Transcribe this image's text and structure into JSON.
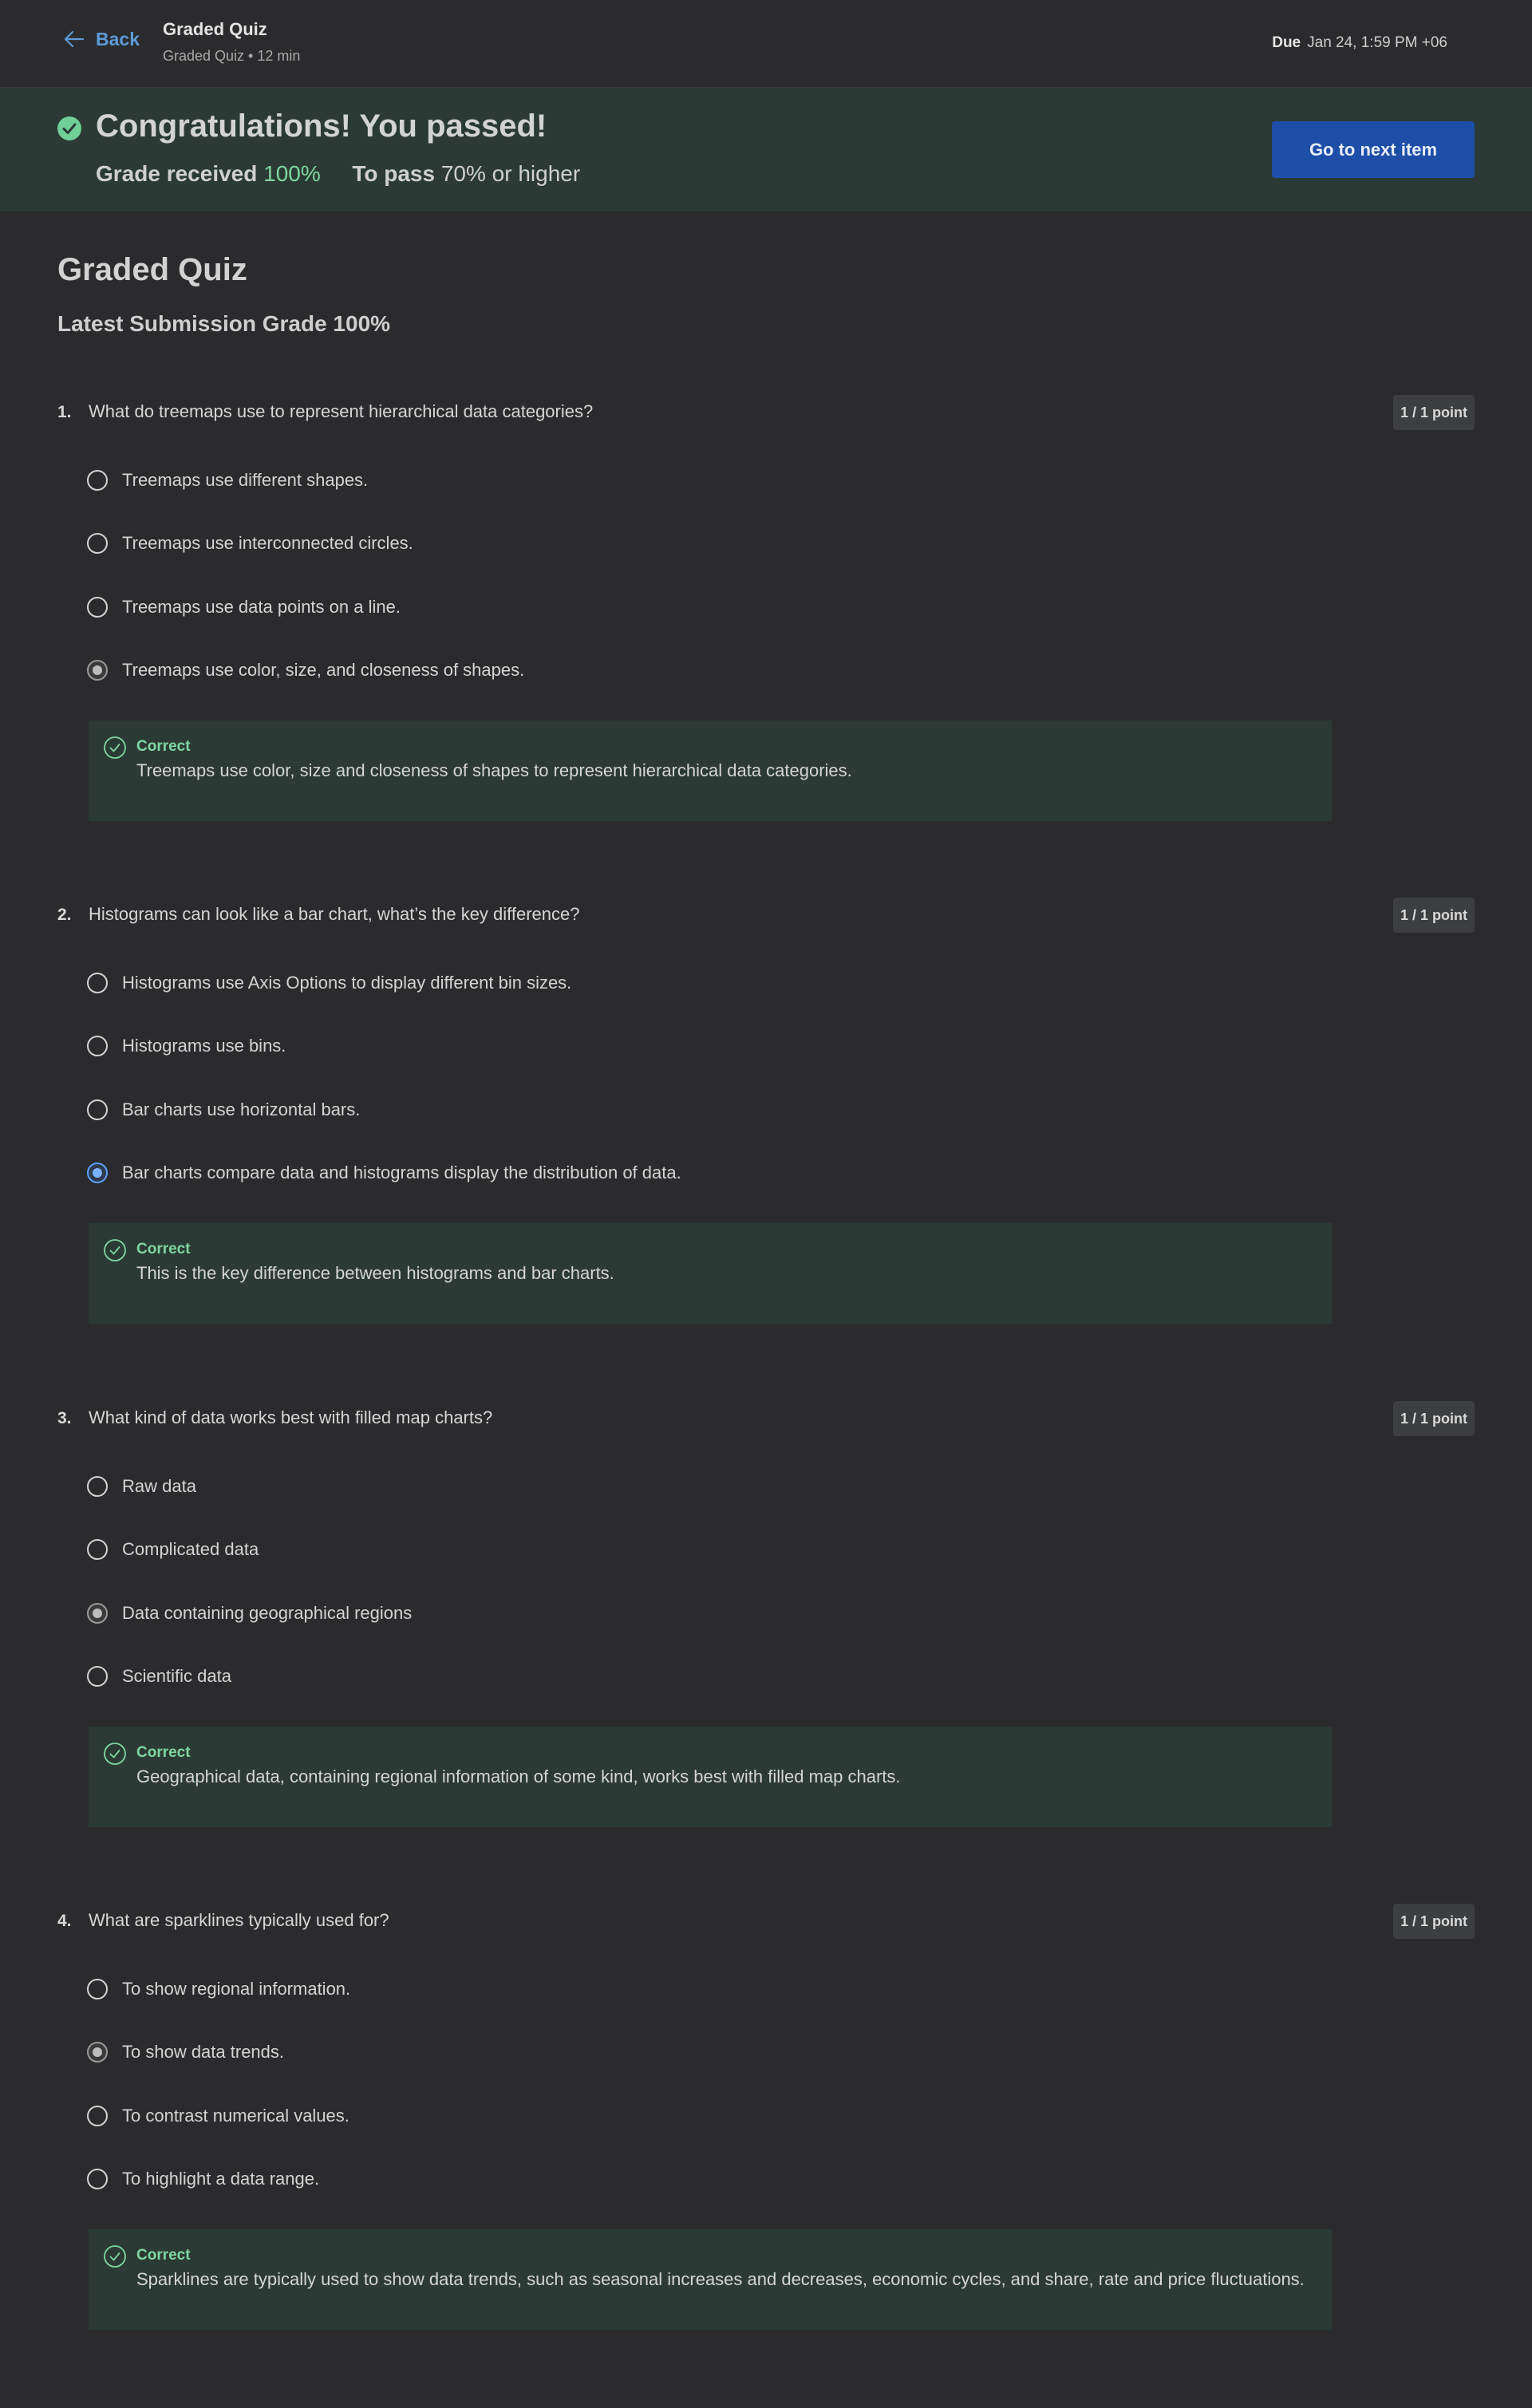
{
  "header": {
    "back_label": "Back",
    "title": "Graded Quiz",
    "subtitle": "Graded Quiz • 12 min",
    "due_label": "Due",
    "due_value": "Jan 24, 1:59 PM +06"
  },
  "banner": {
    "title": "Congratulations! You passed!",
    "grade_label": "Grade received",
    "grade_value": "100%",
    "pass_label": "To pass",
    "pass_value": "70% or higher",
    "next_button": "Go to next item"
  },
  "main": {
    "title": "Graded Quiz",
    "latest_grade": "Latest Submission Grade 100%"
  },
  "colors": {
    "accent": "#1d4ea8",
    "success": "#7fd6a3",
    "link": "#5e9bd8"
  },
  "questions": [
    {
      "number": "1.",
      "text": "What do treemaps use to represent hierarchical data categories?",
      "points": "1 / 1 point",
      "options": [
        "Treemaps use different shapes.",
        "Treemaps use interconnected circles.",
        "Treemaps use data points on a line.",
        "Treemaps use color, size, and closeness of shapes."
      ],
      "selected_index": 3,
      "feedback_title": "Correct",
      "feedback_text": "Treemaps use color, size and closeness of shapes to represent hierarchical data categories."
    },
    {
      "number": "2.",
      "text": "Histograms can look like a bar chart, what’s the key difference?",
      "points": "1 / 1 point",
      "options": [
        "Histograms use Axis Options to display different bin sizes.",
        "Histograms use bins.",
        "Bar charts use horizontal bars.",
        "Bar charts compare data and histograms display the distribution of data."
      ],
      "selected_index": 3,
      "feedback_title": "Correct",
      "feedback_text": "This is the key difference between histograms and bar charts."
    },
    {
      "number": "3.",
      "text": "What kind of data works best with filled map charts?",
      "points": "1 / 1 point",
      "options": [
        "Raw data",
        "Complicated data",
        "Data containing geographical regions",
        "Scientific data"
      ],
      "selected_index": 2,
      "feedback_title": "Correct",
      "feedback_text": "Geographical data, containing regional information of some kind, works best with filled map charts."
    },
    {
      "number": "4.",
      "text": "What are sparklines typically used for?",
      "points": "1 / 1 point",
      "options": [
        "To show regional information.",
        "To show data trends.",
        "To contrast numerical values.",
        "To highlight a data range."
      ],
      "selected_index": 1,
      "feedback_title": "Correct",
      "feedback_text": "Sparklines are typically used to show data trends, such as seasonal increases and decreases, economic cycles, and share, rate and price fluctuations."
    }
  ]
}
